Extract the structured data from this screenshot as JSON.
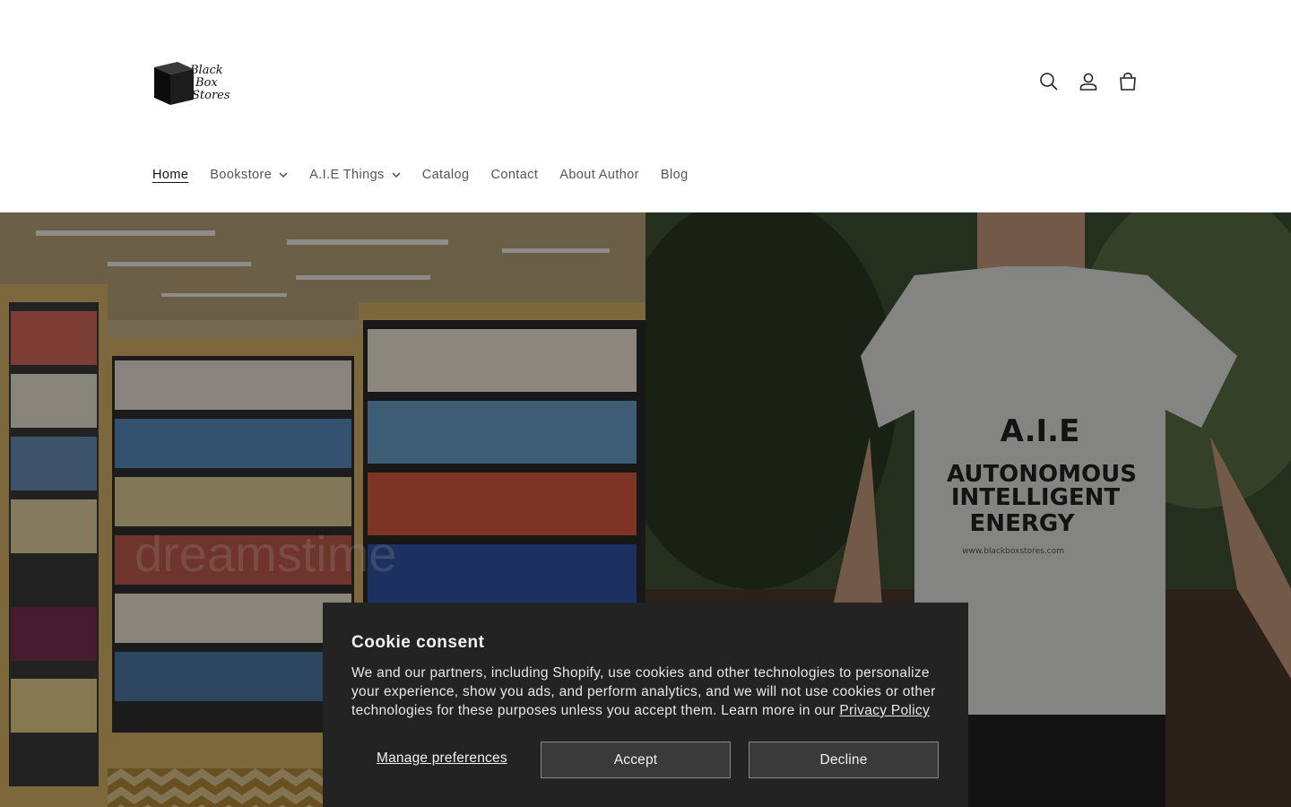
{
  "brand": {
    "logo_lines": [
      "Black",
      "Box",
      "Stores"
    ]
  },
  "header": {
    "icons": [
      "search-icon",
      "account-icon",
      "cart-icon"
    ]
  },
  "nav": {
    "items": [
      {
        "label": "Home",
        "active": true
      },
      {
        "label": "Bookstore",
        "dropdown": true
      },
      {
        "label": "A.I.E Things",
        "dropdown": true
      },
      {
        "label": "Catalog"
      },
      {
        "label": "Contact"
      },
      {
        "label": "About Author"
      },
      {
        "label": "Blog"
      }
    ]
  },
  "hero": {
    "watermark": "dreamstime",
    "shirt": {
      "line1": "A.I.E",
      "line2": "AUTONOMOUS",
      "line3": "INTELLIGENT",
      "line4": "ENERGY",
      "url": "www.blackboxstores.com"
    }
  },
  "cookie": {
    "title": "Cookie consent",
    "body": "We and our partners, including Shopify, use cookies and other technologies to personalize your experience, show you ads, and perform analytics, and we will not use cookies or other technologies for these purposes unless you accept them. Learn more in our ",
    "policy_link": "Privacy Policy",
    "manage_label": "Manage preferences",
    "accept_label": "Accept",
    "decline_label": "Decline"
  },
  "colors": {
    "banner_bg": "#232323",
    "button_bg": "#3a3a3a",
    "nav_text": "#555555"
  }
}
